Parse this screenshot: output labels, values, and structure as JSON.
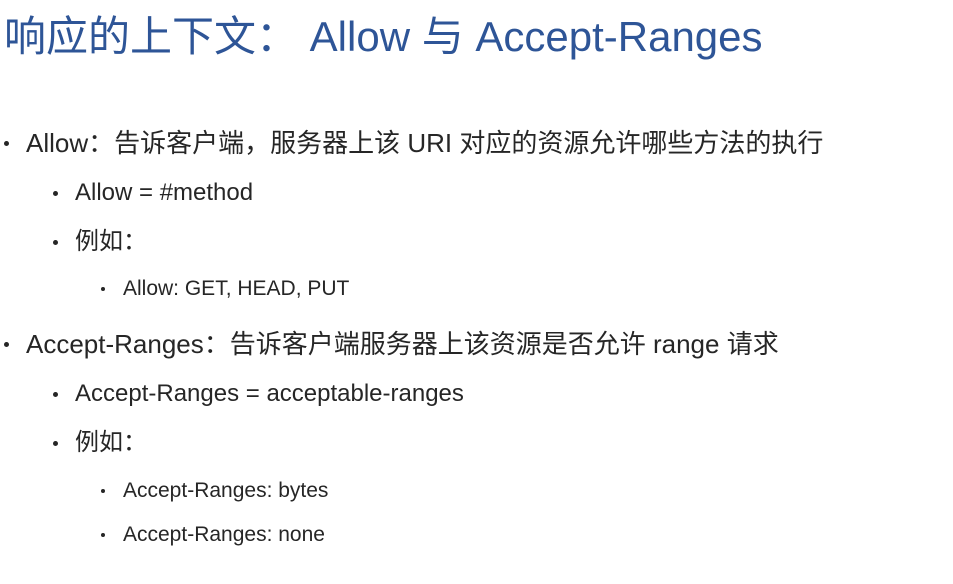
{
  "title": "响应的上下文：  Allow 与 Accept-Ranges",
  "sections": [
    {
      "text": "Allow：告诉客户端，服务器上该 URI 对应的资源允许哪些方法的执行",
      "items": [
        {
          "text": "Allow = #method"
        },
        {
          "text": "例如："
        }
      ],
      "examples": [
        {
          "text": "Allow: GET, HEAD, PUT"
        }
      ]
    },
    {
      "text": "Accept-Ranges：告诉客户端服务器上该资源是否允许 range 请求",
      "items": [
        {
          "text": "Accept-Ranges = acceptable-ranges"
        },
        {
          "text": "例如："
        }
      ],
      "examples": [
        {
          "text": "Accept-Ranges: bytes"
        },
        {
          "text": "Accept-Ranges: none"
        }
      ]
    }
  ]
}
